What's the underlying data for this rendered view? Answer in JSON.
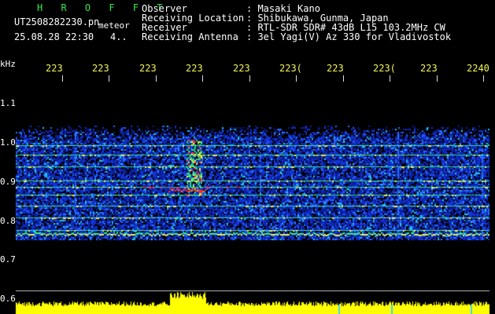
{
  "header": {
    "app_title": "H R O F F T",
    "filename": "UT2508282230.pn",
    "tag": "meteor",
    "datetime": "25.08.28 22:30",
    "counter": "4..",
    "labels": {
      "observer": "Observer",
      "location": "Receiving Location",
      "receiver": "Receiver",
      "antenna": "Receiving Antenna"
    },
    "values": {
      "observer": ": Masaki Kano",
      "location": ": Shibukawa, Gunma, Japan",
      "receiver": ": RTL-SDR SDR# 43dB L15 103.2MHz CW",
      "antenna": ": 3el Yagi(V) Az 330 for Vladivostok"
    }
  },
  "axis": {
    "y_unit": "kHz",
    "y_ticks": [
      "1.1",
      "1.0",
      "0.9",
      "0.8",
      "0.7",
      "0.6"
    ],
    "x_ticks": [
      "223",
      "223",
      "223",
      "223",
      "223",
      "223(",
      "223",
      "223(",
      "223",
      "2240"
    ]
  },
  "colors": {
    "background": "#000000",
    "text": "#ffffff",
    "time_labels": "#f3f35a",
    "title": "#33e64d",
    "noise_band": "#1a3cff",
    "signal": "#ff2020",
    "level_bar": "#ffff00"
  }
}
